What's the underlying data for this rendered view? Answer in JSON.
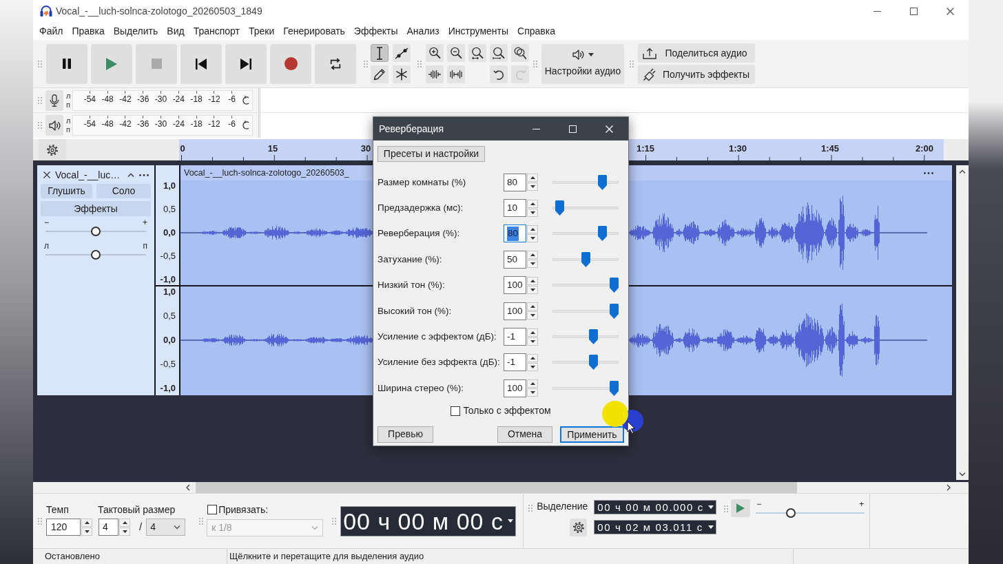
{
  "window": {
    "title": "Vocal_-__luch-solnca-zolotogo_20260503_1849"
  },
  "menu": [
    "Файл",
    "Правка",
    "Выделить",
    "Вид",
    "Транспорт",
    "Треки",
    "Генерировать",
    "Эффекты",
    "Анализ",
    "Инструменты",
    "Справка"
  ],
  "transport": [
    {
      "kind": "pause",
      "disabled": false
    },
    {
      "kind": "play",
      "disabled": false
    },
    {
      "kind": "stop",
      "disabled": true
    },
    {
      "kind": "skip_start",
      "disabled": false
    },
    {
      "kind": "skip_end",
      "disabled": false
    },
    {
      "kind": "record",
      "disabled": false
    },
    {
      "kind": "loop",
      "disabled": false
    }
  ],
  "tools": [
    {
      "kind": "select",
      "selected": true
    },
    {
      "kind": "envelope",
      "selected": false
    },
    {
      "kind": "draw",
      "selected": false
    },
    {
      "kind": "multi",
      "selected": false
    }
  ],
  "edit_tools": [
    {
      "kind": "zoom_in",
      "disabled": false
    },
    {
      "kind": "zoom_out",
      "disabled": false
    },
    {
      "kind": "fit_selection",
      "disabled": false
    },
    {
      "kind": "fit_project",
      "disabled": false
    },
    {
      "kind": "zoom_toggle",
      "disabled": false
    },
    {
      "kind": "trim",
      "disabled": false
    },
    {
      "kind": "silence",
      "disabled": false
    },
    {
      "kind": "undo",
      "disabled": false
    },
    {
      "kind": "redo",
      "disabled": true
    }
  ],
  "audio_setup": {
    "label": "Настройки аудио"
  },
  "share_toolbar": [
    {
      "kind": "share",
      "label": "Поделиться аудио"
    },
    {
      "kind": "plugins",
      "label": "Получить эффекты"
    }
  ],
  "meters": [
    {
      "kind": "record",
      "channels": [
        "л",
        "п"
      ],
      "scale": [
        "-54",
        "-48",
        "-42",
        "-36",
        "-30",
        "-24",
        "-18",
        "-12",
        "-6"
      ]
    },
    {
      "kind": "playback",
      "channels": [
        "л",
        "п"
      ],
      "scale": [
        "-54",
        "-48",
        "-42",
        "-36",
        "-30",
        "-24",
        "-18",
        "-12",
        "-6"
      ]
    }
  ],
  "ruler": {
    "labels": [
      "0",
      "15",
      "30",
      "1:15",
      "1:30",
      "1:45",
      "2:00"
    ]
  },
  "track": {
    "name": "Vocal_-__luc…",
    "mute": "Глушить",
    "solo": "Соло",
    "effects": "Эффекты",
    "gain": {
      "min_label": "−",
      "max_label": "+",
      "level": 0.5
    },
    "pan": {
      "min_label": "л",
      "max_label": "п",
      "level": 0.5
    },
    "channels": [
      {
        "scale": [
          "1,0",
          "0,5",
          "0,0",
          "-0,5",
          "-1,0"
        ]
      },
      {
        "scale": [
          "1,0",
          "0,5",
          "0,0",
          "-0,5",
          "-1,0"
        ]
      }
    ],
    "clip_title": "Vocal_-__luch-solnca-zolotogo_20260503_"
  },
  "dialog": {
    "title": "Реверберация",
    "presets_button": "Пресеты и настройки",
    "params": [
      {
        "label": "Размер комнаты (%)",
        "value": "80",
        "level": 0.8,
        "focused": false
      },
      {
        "label": "Предзадержка (мс):",
        "value": "10",
        "level": 0.05,
        "focused": false
      },
      {
        "label": "Реверберация (%):",
        "value": "80",
        "level": 0.8,
        "focused": true
      },
      {
        "label": "Затухание (%):",
        "value": "50",
        "level": 0.5,
        "focused": false
      },
      {
        "label": "Низкий тон (%):",
        "value": "100",
        "level": 1,
        "focused": false
      },
      {
        "label": "Высокий тон (%):",
        "value": "100",
        "level": 1,
        "focused": false
      },
      {
        "label": "Усиление с эффектом (дБ):",
        "value": "-1",
        "level": 0.633,
        "focused": false
      },
      {
        "label": "Усиление без эффекта (дБ):",
        "value": "-1",
        "level": 0.633,
        "focused": false
      },
      {
        "label": "Ширина стерео (%):",
        "value": "100",
        "level": 1,
        "focused": false
      }
    ],
    "wet_only": {
      "label": "Только с эффектом",
      "checked": false
    },
    "buttons": [
      {
        "label": "Превью",
        "default": false
      },
      {
        "label": "Отмена",
        "default": false
      },
      {
        "label": "Применить",
        "default": true
      }
    ]
  },
  "bottom_toolbar": {
    "tempo": {
      "label": "Темп",
      "value": "120"
    },
    "time_signature": {
      "label": "Тактовый размер",
      "upper": "4",
      "separator": "/",
      "lower": "4"
    },
    "snap": {
      "label": "Привязать:",
      "checked": false,
      "value": "к 1/8",
      "disabled": true
    },
    "time": "00 ч 00 м 00 с",
    "selection": {
      "label": "Выделение",
      "start": "00 ч 00 м 00.000 с",
      "end": "00 ч 02 м 03.011 с"
    },
    "play_at_speed": {
      "min_label": "−",
      "max_label": "+",
      "level": 0.3
    }
  },
  "status_bar": [
    "Остановлено",
    "Щёлкните и перетащите для выделения аудио"
  ]
}
